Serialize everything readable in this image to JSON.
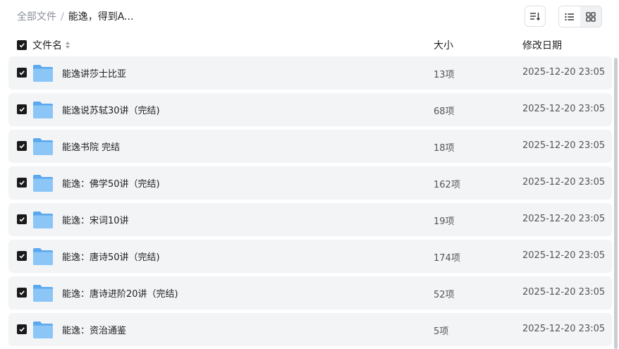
{
  "breadcrumb": {
    "root": "全部文件",
    "separator": "/",
    "current": "能逸，得到A..."
  },
  "header": {
    "name": "文件名",
    "size": "大小",
    "modified": "修改日期"
  },
  "rows": [
    {
      "name": "能逸讲莎士比亚",
      "size": "13项",
      "date": "2025-12-20 23:05"
    },
    {
      "name": "能逸说苏轼30讲（完结)",
      "size": "68项",
      "date": "2025-12-20 23:05"
    },
    {
      "name": "能逸书院 完结",
      "size": "18项",
      "date": "2025-12-20 23:05"
    },
    {
      "name": "能逸：佛学50讲（完结)",
      "size": "162项",
      "date": "2025-12-20 23:05"
    },
    {
      "name": "能逸：宋词10讲",
      "size": "19项",
      "date": "2025-12-20 23:05"
    },
    {
      "name": "能逸：唐诗50讲（完结)",
      "size": "174项",
      "date": "2025-12-20 23:05"
    },
    {
      "name": "能逸：唐诗进阶20讲（完结)",
      "size": "52项",
      "date": "2025-12-20 23:05"
    },
    {
      "name": "能逸：资治通鉴",
      "size": "5项",
      "date": "2025-12-20 23:05"
    }
  ],
  "icons": {
    "sort": "sort-icon",
    "list_view": "list-view-icon",
    "grid_view": "grid-view-icon",
    "folder": "folder-icon",
    "checkbox": "checkbox-checked-icon"
  },
  "colors": {
    "row_background": "#f3f4f6",
    "checkbox": "#1a1a1a",
    "folder": "#6fb6f5"
  }
}
